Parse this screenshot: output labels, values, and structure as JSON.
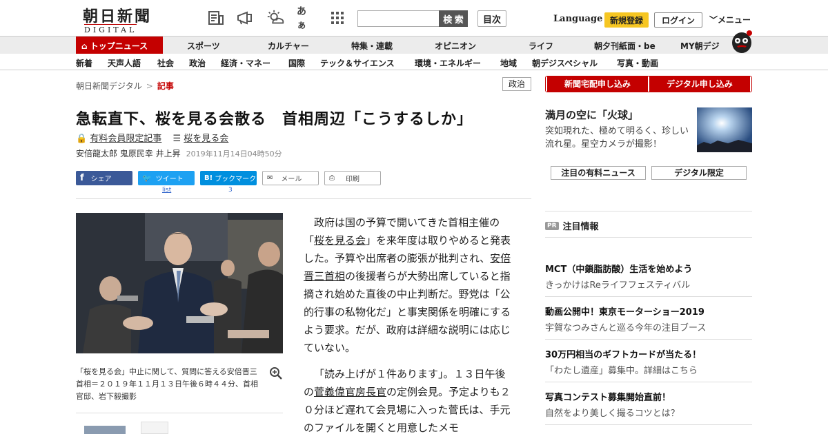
{
  "header": {
    "logo_jp": "朝日新聞",
    "logo_en": "DIGITAL",
    "search_button": "検 索",
    "toc_button": "目次",
    "language": "Language",
    "register": "新規登録",
    "login": "ログイン",
    "menu": "メニュー",
    "kana_icon_text": "あぁ"
  },
  "nav_primary": {
    "top_news": "トップニュース",
    "items": [
      "スポーツ",
      "カルチャー",
      "特集・連載",
      "オピニオン",
      "ライフ",
      "朝夕刊紙面・be",
      "MY朝デジ"
    ]
  },
  "nav_secondary": {
    "items": [
      "新着",
      "天声人語",
      "社会",
      "政治",
      "経済・マネー",
      "国際",
      "テック＆サイエンス",
      "環境・エネルギー",
      "地域",
      "朝デジスペシャル",
      "写真・動画"
    ]
  },
  "breadcrumb": {
    "home": "朝日新聞デジタル",
    "sep": ">",
    "current": "記事"
  },
  "category_tag": "政治",
  "article": {
    "headline": "急転直下、桜を見る会散る　首相周辺「こうするしか」",
    "members_only": "有料会員限定記事",
    "topic": "桜を見る会",
    "authors": "安倍龍太郎 鬼原民幸 井上昇",
    "date": "2019年11月14日04時50分"
  },
  "share": {
    "facebook": "シェア",
    "twitter": "ツイート",
    "twitter_count": "list",
    "hatena": "ブックマーク",
    "hatena_count": "3",
    "mail": "メール",
    "print": "印刷"
  },
  "photo": {
    "caption": "「桜を見る会」中止に関して、質問に答える安倍晋三首相＝２０１９年１１月１３日午後６時４４分、首相官邸、岩下毅撮影"
  },
  "body": {
    "p1_a": "政府は国の予算で開いてきた首相主催の「",
    "p1_link1": "桜を見る会",
    "p1_b": "」を来年度は取りやめると発表した。予算や出席者の膨張が批判され、",
    "p1_link2": "安倍晋三首相",
    "p1_c": "の後援者らが大勢出席していると指摘され始めた直後の中止判断だ。野党は「公的行事の私物化だ」と事実関係を明確にするよう要求。だが、政府は詳細な説明には応じていない。",
    "p2_a": "「読み上げが１件あります」。１３日午後の",
    "p2_link": "菅義偉官房長官",
    "p2_b": "の定例会見。予定よりも２０分ほど遅れて会見場に入った菅氏は、手元のファイルを開くと用意したメモ"
  },
  "sidebar": {
    "subscribe_paper": "新聞宅配申し込み",
    "subscribe_digital": "デジタル申し込み",
    "feature_title": "満月の空に「火球」",
    "feature_desc": "突如現れた、極めて明るく、珍しい流れ星。星空カメラが撮影！",
    "tab1": "注目の有料ニュース",
    "tab2": "デジタル限定",
    "pr_badge": "PR",
    "pr_title": "注目情報",
    "pr_items": [
      {
        "title": "MCT（中鎖脂肪酸）生活を始めよう",
        "sub": "きっかけはReライフフェスティバル"
      },
      {
        "title": "動画公開中！東京モーターショー2019",
        "sub": "宇賀なつみさんと巡る今年の注目ブース"
      },
      {
        "title": "30万円相当のギフトカードが当たる！",
        "sub": "「わたし遺産」募集中。詳細はこちら"
      },
      {
        "title": "写真コンテスト募集開始直前！",
        "sub": "自然をより美しく撮るコツとは？"
      }
    ]
  },
  "colors": {
    "brand_red": "#c40000",
    "register_yellow": "#f6c623",
    "facebook": "#3b5998",
    "twitter": "#1da1f2",
    "hatena": "#008fde"
  }
}
